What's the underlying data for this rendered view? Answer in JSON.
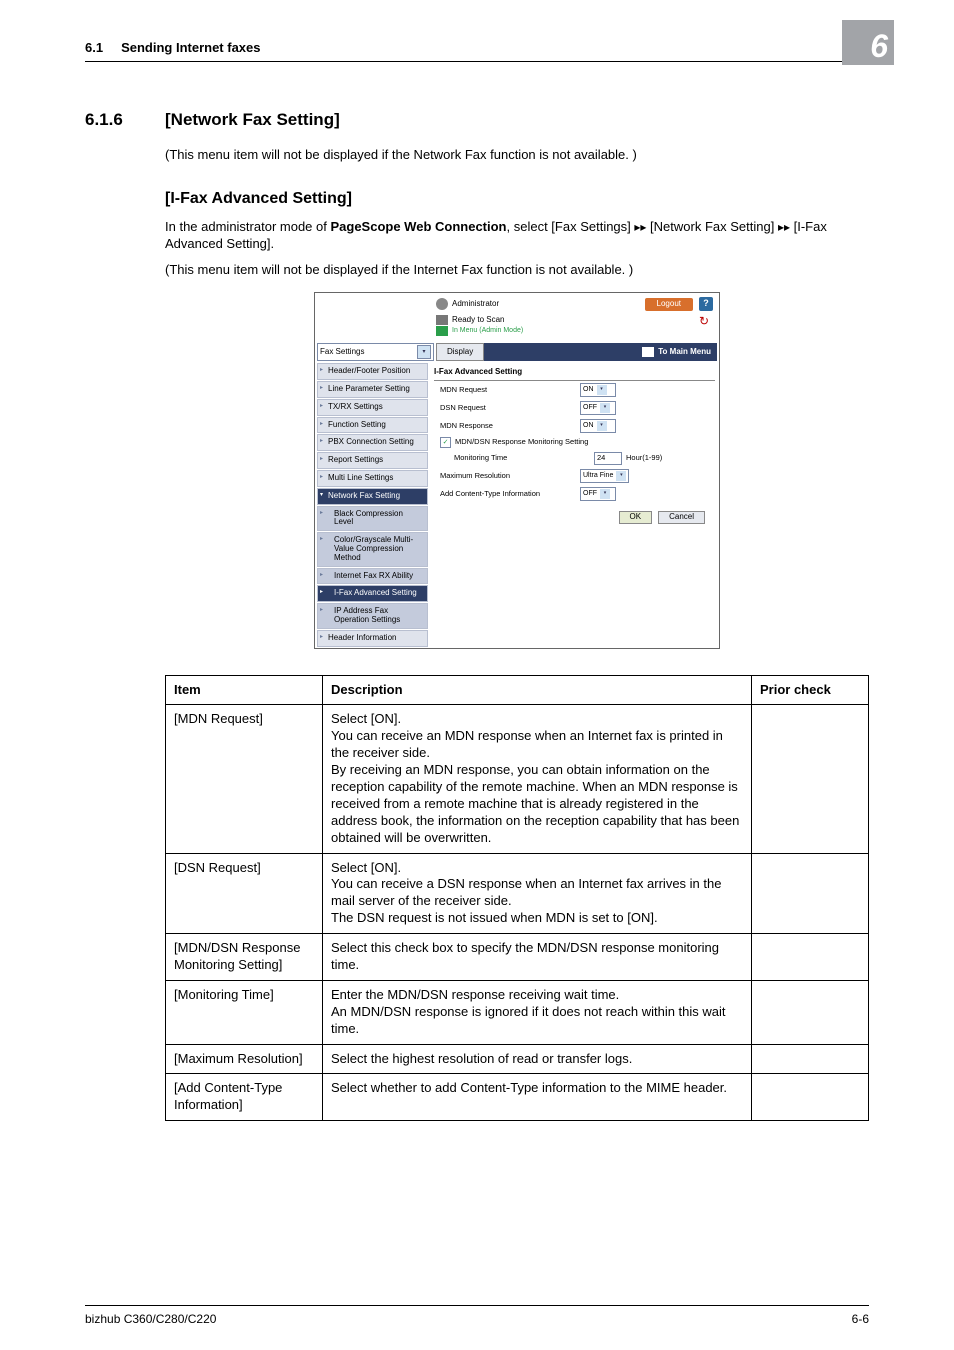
{
  "header": {
    "section_number": "6.1",
    "section_title": "Sending Internet faxes",
    "chapter": "6"
  },
  "section": {
    "num": "6.1.6",
    "title": "[Network Fax Setting]",
    "note": "(This menu item will not be displayed if the Network Fax function is not available. )",
    "sub_title": "[I-Fax Advanced Setting]",
    "intro_1": "In the administrator mode of ",
    "intro_bold": "PageScope Web Connection",
    "intro_2": ", select [Fax Settings] ",
    "intro_3": " [Network Fax Setting] ",
    "intro_4": " [I-Fax Advanced Setting].",
    "note2": "(This menu item will not be displayed if the Internet Fax function is not available. )"
  },
  "shot": {
    "admin": "Administrator",
    "logout": "Logout",
    "help": "?",
    "status": "Ready to Scan",
    "menu_mode": "In Menu (Admin Mode)",
    "dropdown": "Fax Settings",
    "display": "Display",
    "to_main": "To Main Menu",
    "sidebar": [
      "Header/Footer Position",
      "Line Parameter Setting",
      "TX/RX Settings",
      "Function Setting",
      "PBX Connection Setting",
      "Report Settings",
      "Multi Line Settings"
    ],
    "sidebar_head": "Network Fax Setting",
    "sidebar_sub": [
      "Black Compression Level",
      "Color/Grayscale Multi-Value Compression Method",
      "Internet Fax RX Ability",
      "I-Fax Advanced Setting",
      "IP Address Fax Operation Settings"
    ],
    "sidebar_tail": "Header Information",
    "panel_title": "I-Fax Advanced Setting",
    "rows": {
      "mdn_req": {
        "label": "MDN Request",
        "value": "ON"
      },
      "dsn_req": {
        "label": "DSN Request",
        "value": "OFF"
      },
      "mdn_resp": {
        "label": "MDN Response",
        "value": "ON"
      },
      "monset": {
        "label": "MDN/DSN Response Monitoring Setting"
      },
      "montime": {
        "label": "Monitoring Time",
        "value": "24",
        "unit": "Hour(1-99)"
      },
      "maxres": {
        "label": "Maximum Resolution",
        "value": "Ultra Fine"
      },
      "addct": {
        "label": "Add Content-Type Information",
        "value": "OFF"
      }
    },
    "ok": "OK",
    "cancel": "Cancel"
  },
  "table": {
    "head": {
      "item": "Item",
      "desc": "Description",
      "prior": "Prior check"
    },
    "rows": [
      {
        "item": "[MDN Request]",
        "desc": "Select [ON].\nYou can receive an MDN response when an Internet fax is printed in the receiver side.\nBy receiving an MDN response, you can obtain information on the reception capability of the remote machine. When an MDN response is received from a remote machine that is already registered in the address book, the information on the reception capability that has been obtained will be overwritten.",
        "prior": ""
      },
      {
        "item": "[DSN Request]",
        "desc": "Select [ON].\nYou can receive a DSN response when an Internet fax arrives in the mail server of the receiver side.\nThe DSN request is not issued when MDN is set to [ON].",
        "prior": ""
      },
      {
        "item": "[MDN/DSN Response Monitoring Setting]",
        "desc": "Select this check box to specify the MDN/DSN response monitoring time.",
        "prior": ""
      },
      {
        "item": "[Monitoring Time]",
        "desc": "Enter the MDN/DSN response receiving wait time.\nAn MDN/DSN response is ignored if it does not reach within this wait time.",
        "prior": ""
      },
      {
        "item": "[Maximum Resolution]",
        "desc": "Select the highest resolution of read or transfer logs.",
        "prior": ""
      },
      {
        "item": "[Add Content-Type Information]",
        "desc": "Select whether to add Content-Type information to the MIME header.",
        "prior": ""
      }
    ]
  },
  "footer": {
    "left": "bizhub C360/C280/C220",
    "right": "6-6"
  }
}
